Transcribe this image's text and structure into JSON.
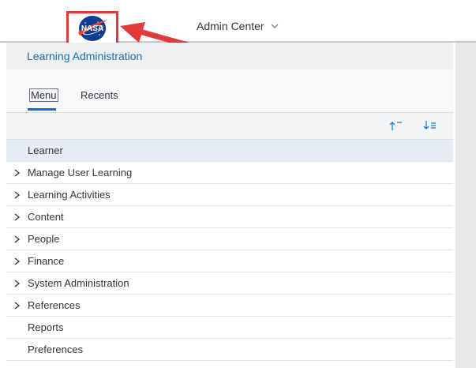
{
  "topbar": {
    "logo_text": "NASA",
    "admin_center_label": "Admin Center"
  },
  "panel": {
    "title": "Learning Administration",
    "tabs": [
      {
        "label": "Menu",
        "active": true
      },
      {
        "label": "Recents",
        "active": false
      }
    ],
    "sort": {
      "asc_icon": "sort-ascending-icon",
      "desc_icon": "sort-descending-icon"
    },
    "items": [
      {
        "label": "Learner",
        "expandable": false,
        "selected": true
      },
      {
        "label": "Manage User Learning",
        "expandable": true
      },
      {
        "label": "Learning Activities",
        "expandable": true
      },
      {
        "label": "Content",
        "expandable": true
      },
      {
        "label": "People",
        "expandable": true
      },
      {
        "label": "Finance",
        "expandable": true
      },
      {
        "label": "System Administration",
        "expandable": true
      },
      {
        "label": "References",
        "expandable": true
      },
      {
        "label": "Reports",
        "expandable": false
      },
      {
        "label": "Preferences",
        "expandable": false
      }
    ]
  },
  "colors": {
    "accent": "#0a6ed1",
    "header_text": "#1a6ead",
    "annotation_red": "#e23a3a"
  }
}
